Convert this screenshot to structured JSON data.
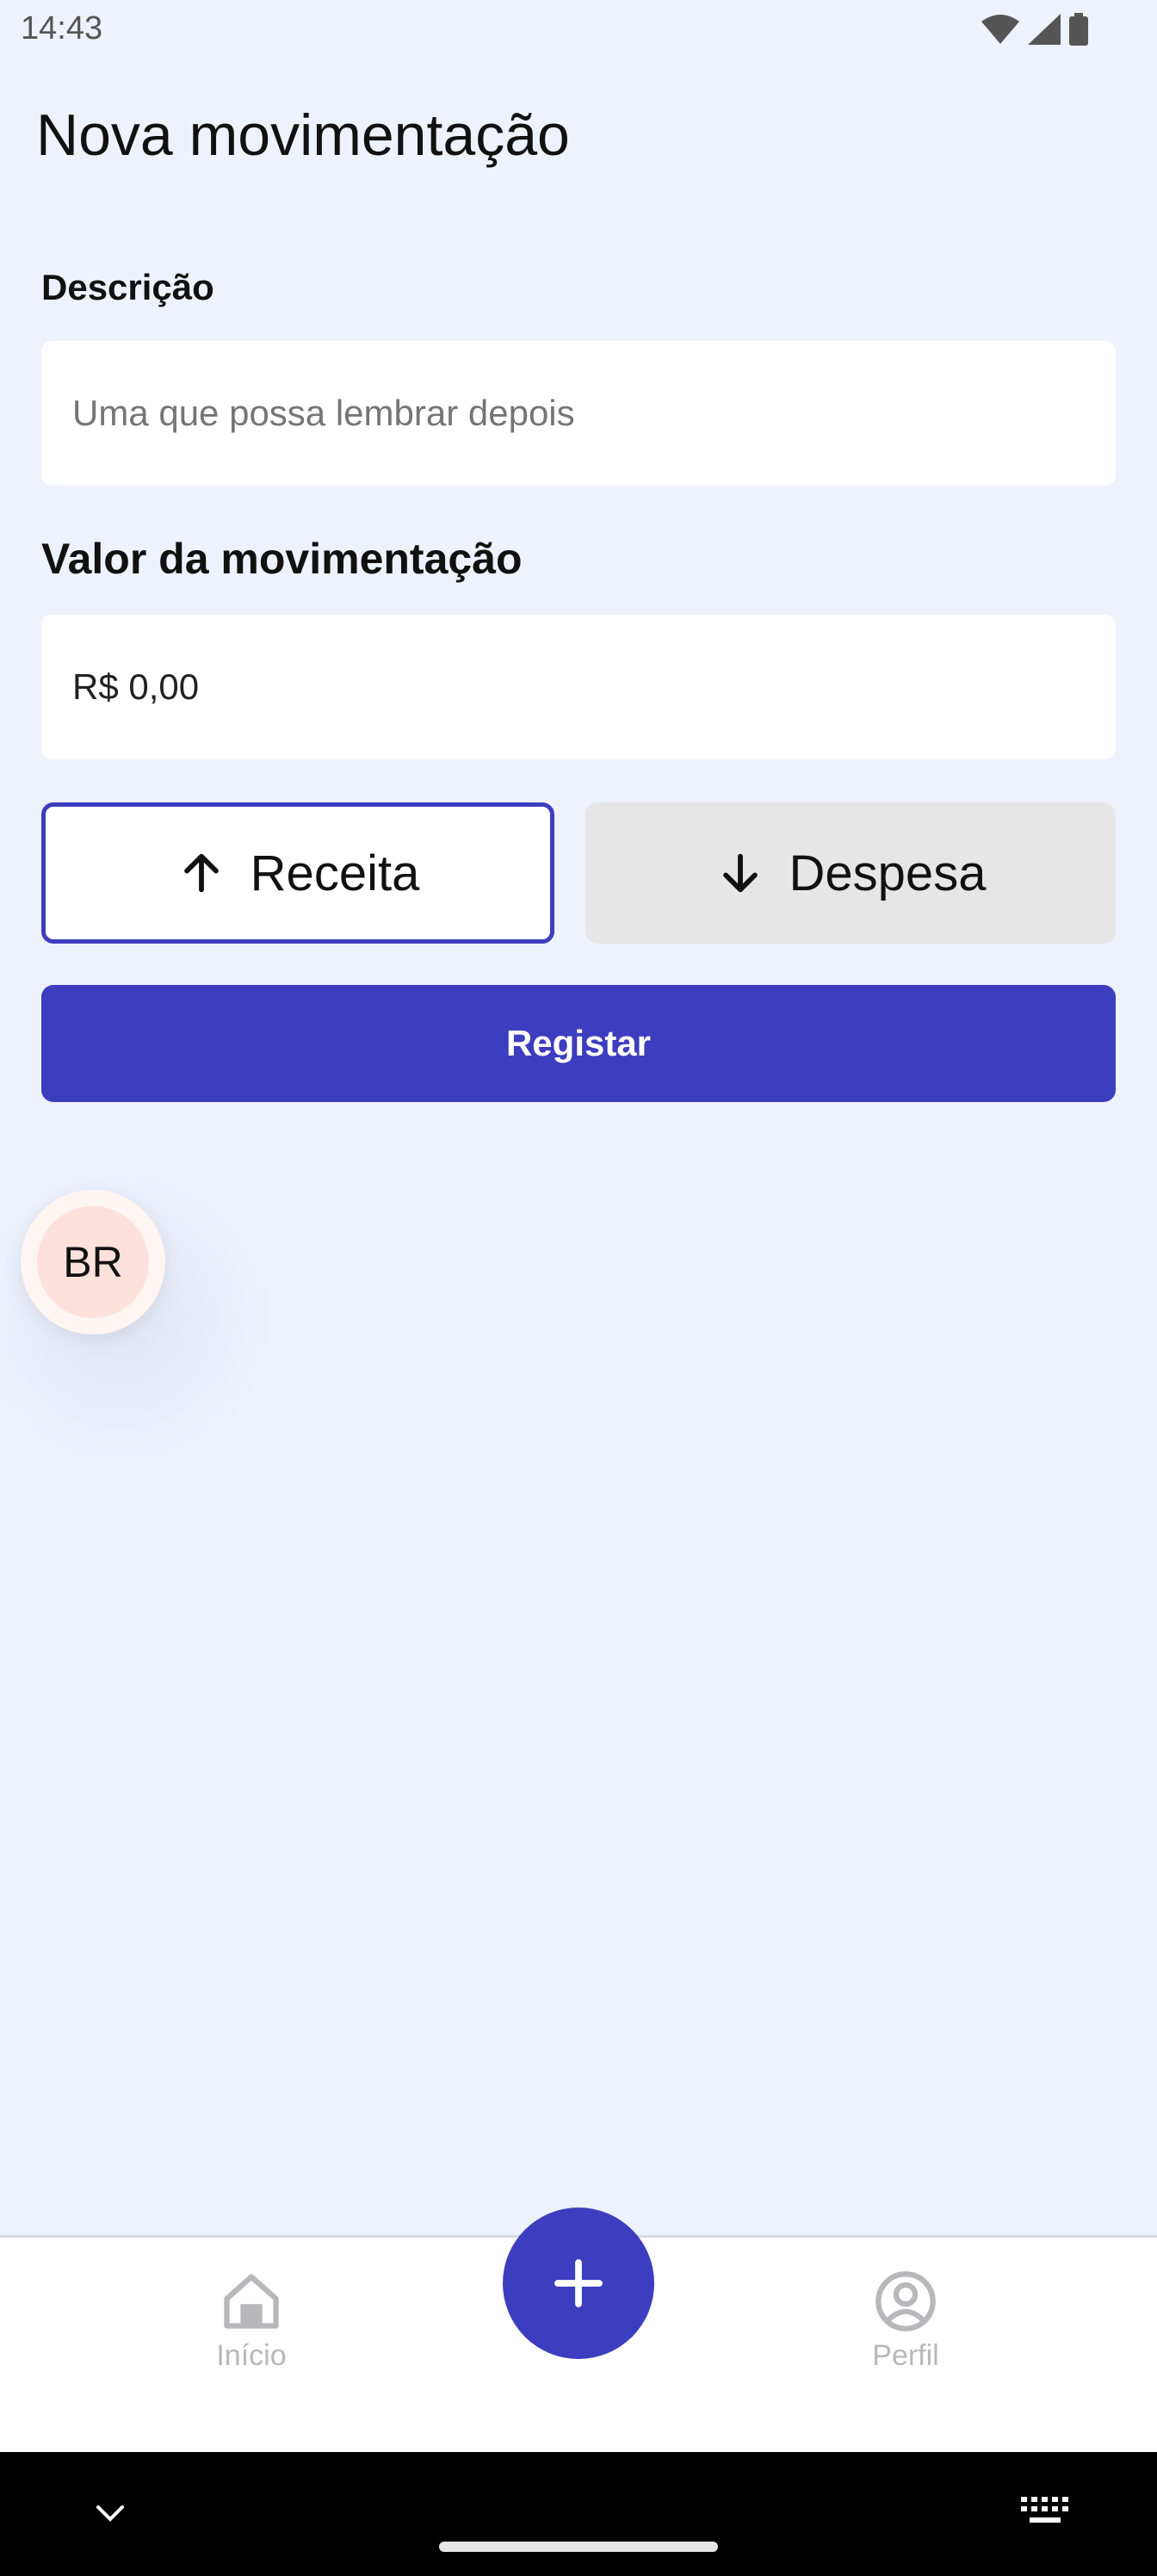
{
  "status_bar": {
    "time": "14:43"
  },
  "page": {
    "title": "Nova movimentação"
  },
  "form": {
    "description_label": "Descrição",
    "description_placeholder": "Uma que possa lembrar depois",
    "amount_label": "Valor da movimentação",
    "amount_value": "R$ 0,00",
    "income_label": "Receita",
    "expense_label": "Despesa",
    "selected_type": "Receita",
    "submit_label": "Registar"
  },
  "floating_bubble": {
    "initials": "BR"
  },
  "bottom_nav": {
    "items": [
      {
        "label": "Início",
        "icon": "home-icon"
      },
      {
        "label": "Perfil",
        "icon": "user-circle-icon"
      }
    ],
    "fab_icon": "plus-icon"
  },
  "colors": {
    "accent": "#3d3dbf",
    "background": "#eef2fd",
    "nav_inactive": "#b8b8bc",
    "bubble": "#fde2dc"
  }
}
